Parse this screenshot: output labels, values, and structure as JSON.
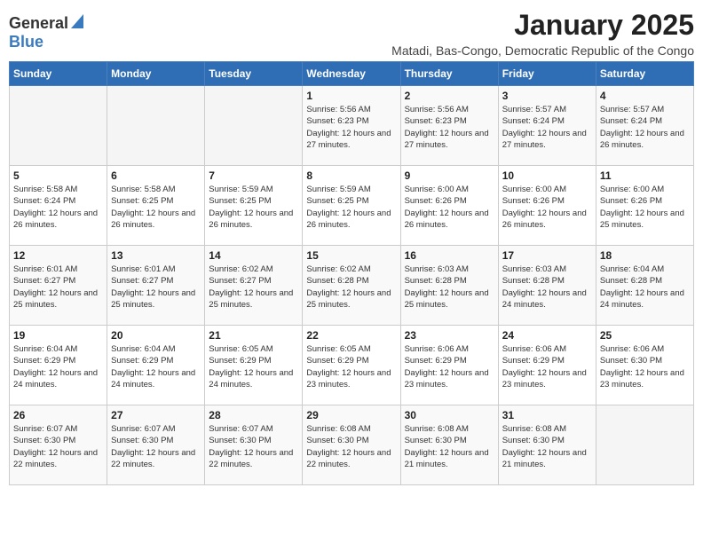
{
  "header": {
    "logo_general": "General",
    "logo_blue": "Blue",
    "month_title": "January 2025",
    "subtitle": "Matadi, Bas-Congo, Democratic Republic of the Congo"
  },
  "columns": [
    "Sunday",
    "Monday",
    "Tuesday",
    "Wednesday",
    "Thursday",
    "Friday",
    "Saturday"
  ],
  "weeks": [
    [
      {
        "day": "",
        "sunrise": "",
        "sunset": "",
        "daylight": ""
      },
      {
        "day": "",
        "sunrise": "",
        "sunset": "",
        "daylight": ""
      },
      {
        "day": "",
        "sunrise": "",
        "sunset": "",
        "daylight": ""
      },
      {
        "day": "1",
        "sunrise": "Sunrise: 5:56 AM",
        "sunset": "Sunset: 6:23 PM",
        "daylight": "Daylight: 12 hours and 27 minutes."
      },
      {
        "day": "2",
        "sunrise": "Sunrise: 5:56 AM",
        "sunset": "Sunset: 6:23 PM",
        "daylight": "Daylight: 12 hours and 27 minutes."
      },
      {
        "day": "3",
        "sunrise": "Sunrise: 5:57 AM",
        "sunset": "Sunset: 6:24 PM",
        "daylight": "Daylight: 12 hours and 27 minutes."
      },
      {
        "day": "4",
        "sunrise": "Sunrise: 5:57 AM",
        "sunset": "Sunset: 6:24 PM",
        "daylight": "Daylight: 12 hours and 26 minutes."
      }
    ],
    [
      {
        "day": "5",
        "sunrise": "Sunrise: 5:58 AM",
        "sunset": "Sunset: 6:24 PM",
        "daylight": "Daylight: 12 hours and 26 minutes."
      },
      {
        "day": "6",
        "sunrise": "Sunrise: 5:58 AM",
        "sunset": "Sunset: 6:25 PM",
        "daylight": "Daylight: 12 hours and 26 minutes."
      },
      {
        "day": "7",
        "sunrise": "Sunrise: 5:59 AM",
        "sunset": "Sunset: 6:25 PM",
        "daylight": "Daylight: 12 hours and 26 minutes."
      },
      {
        "day": "8",
        "sunrise": "Sunrise: 5:59 AM",
        "sunset": "Sunset: 6:25 PM",
        "daylight": "Daylight: 12 hours and 26 minutes."
      },
      {
        "day": "9",
        "sunrise": "Sunrise: 6:00 AM",
        "sunset": "Sunset: 6:26 PM",
        "daylight": "Daylight: 12 hours and 26 minutes."
      },
      {
        "day": "10",
        "sunrise": "Sunrise: 6:00 AM",
        "sunset": "Sunset: 6:26 PM",
        "daylight": "Daylight: 12 hours and 26 minutes."
      },
      {
        "day": "11",
        "sunrise": "Sunrise: 6:00 AM",
        "sunset": "Sunset: 6:26 PM",
        "daylight": "Daylight: 12 hours and 25 minutes."
      }
    ],
    [
      {
        "day": "12",
        "sunrise": "Sunrise: 6:01 AM",
        "sunset": "Sunset: 6:27 PM",
        "daylight": "Daylight: 12 hours and 25 minutes."
      },
      {
        "day": "13",
        "sunrise": "Sunrise: 6:01 AM",
        "sunset": "Sunset: 6:27 PM",
        "daylight": "Daylight: 12 hours and 25 minutes."
      },
      {
        "day": "14",
        "sunrise": "Sunrise: 6:02 AM",
        "sunset": "Sunset: 6:27 PM",
        "daylight": "Daylight: 12 hours and 25 minutes."
      },
      {
        "day": "15",
        "sunrise": "Sunrise: 6:02 AM",
        "sunset": "Sunset: 6:28 PM",
        "daylight": "Daylight: 12 hours and 25 minutes."
      },
      {
        "day": "16",
        "sunrise": "Sunrise: 6:03 AM",
        "sunset": "Sunset: 6:28 PM",
        "daylight": "Daylight: 12 hours and 25 minutes."
      },
      {
        "day": "17",
        "sunrise": "Sunrise: 6:03 AM",
        "sunset": "Sunset: 6:28 PM",
        "daylight": "Daylight: 12 hours and 24 minutes."
      },
      {
        "day": "18",
        "sunrise": "Sunrise: 6:04 AM",
        "sunset": "Sunset: 6:28 PM",
        "daylight": "Daylight: 12 hours and 24 minutes."
      }
    ],
    [
      {
        "day": "19",
        "sunrise": "Sunrise: 6:04 AM",
        "sunset": "Sunset: 6:29 PM",
        "daylight": "Daylight: 12 hours and 24 minutes."
      },
      {
        "day": "20",
        "sunrise": "Sunrise: 6:04 AM",
        "sunset": "Sunset: 6:29 PM",
        "daylight": "Daylight: 12 hours and 24 minutes."
      },
      {
        "day": "21",
        "sunrise": "Sunrise: 6:05 AM",
        "sunset": "Sunset: 6:29 PM",
        "daylight": "Daylight: 12 hours and 24 minutes."
      },
      {
        "day": "22",
        "sunrise": "Sunrise: 6:05 AM",
        "sunset": "Sunset: 6:29 PM",
        "daylight": "Daylight: 12 hours and 23 minutes."
      },
      {
        "day": "23",
        "sunrise": "Sunrise: 6:06 AM",
        "sunset": "Sunset: 6:29 PM",
        "daylight": "Daylight: 12 hours and 23 minutes."
      },
      {
        "day": "24",
        "sunrise": "Sunrise: 6:06 AM",
        "sunset": "Sunset: 6:29 PM",
        "daylight": "Daylight: 12 hours and 23 minutes."
      },
      {
        "day": "25",
        "sunrise": "Sunrise: 6:06 AM",
        "sunset": "Sunset: 6:30 PM",
        "daylight": "Daylight: 12 hours and 23 minutes."
      }
    ],
    [
      {
        "day": "26",
        "sunrise": "Sunrise: 6:07 AM",
        "sunset": "Sunset: 6:30 PM",
        "daylight": "Daylight: 12 hours and 22 minutes."
      },
      {
        "day": "27",
        "sunrise": "Sunrise: 6:07 AM",
        "sunset": "Sunset: 6:30 PM",
        "daylight": "Daylight: 12 hours and 22 minutes."
      },
      {
        "day": "28",
        "sunrise": "Sunrise: 6:07 AM",
        "sunset": "Sunset: 6:30 PM",
        "daylight": "Daylight: 12 hours and 22 minutes."
      },
      {
        "day": "29",
        "sunrise": "Sunrise: 6:08 AM",
        "sunset": "Sunset: 6:30 PM",
        "daylight": "Daylight: 12 hours and 22 minutes."
      },
      {
        "day": "30",
        "sunrise": "Sunrise: 6:08 AM",
        "sunset": "Sunset: 6:30 PM",
        "daylight": "Daylight: 12 hours and 21 minutes."
      },
      {
        "day": "31",
        "sunrise": "Sunrise: 6:08 AM",
        "sunset": "Sunset: 6:30 PM",
        "daylight": "Daylight: 12 hours and 21 minutes."
      },
      {
        "day": "",
        "sunrise": "",
        "sunset": "",
        "daylight": ""
      }
    ]
  ]
}
